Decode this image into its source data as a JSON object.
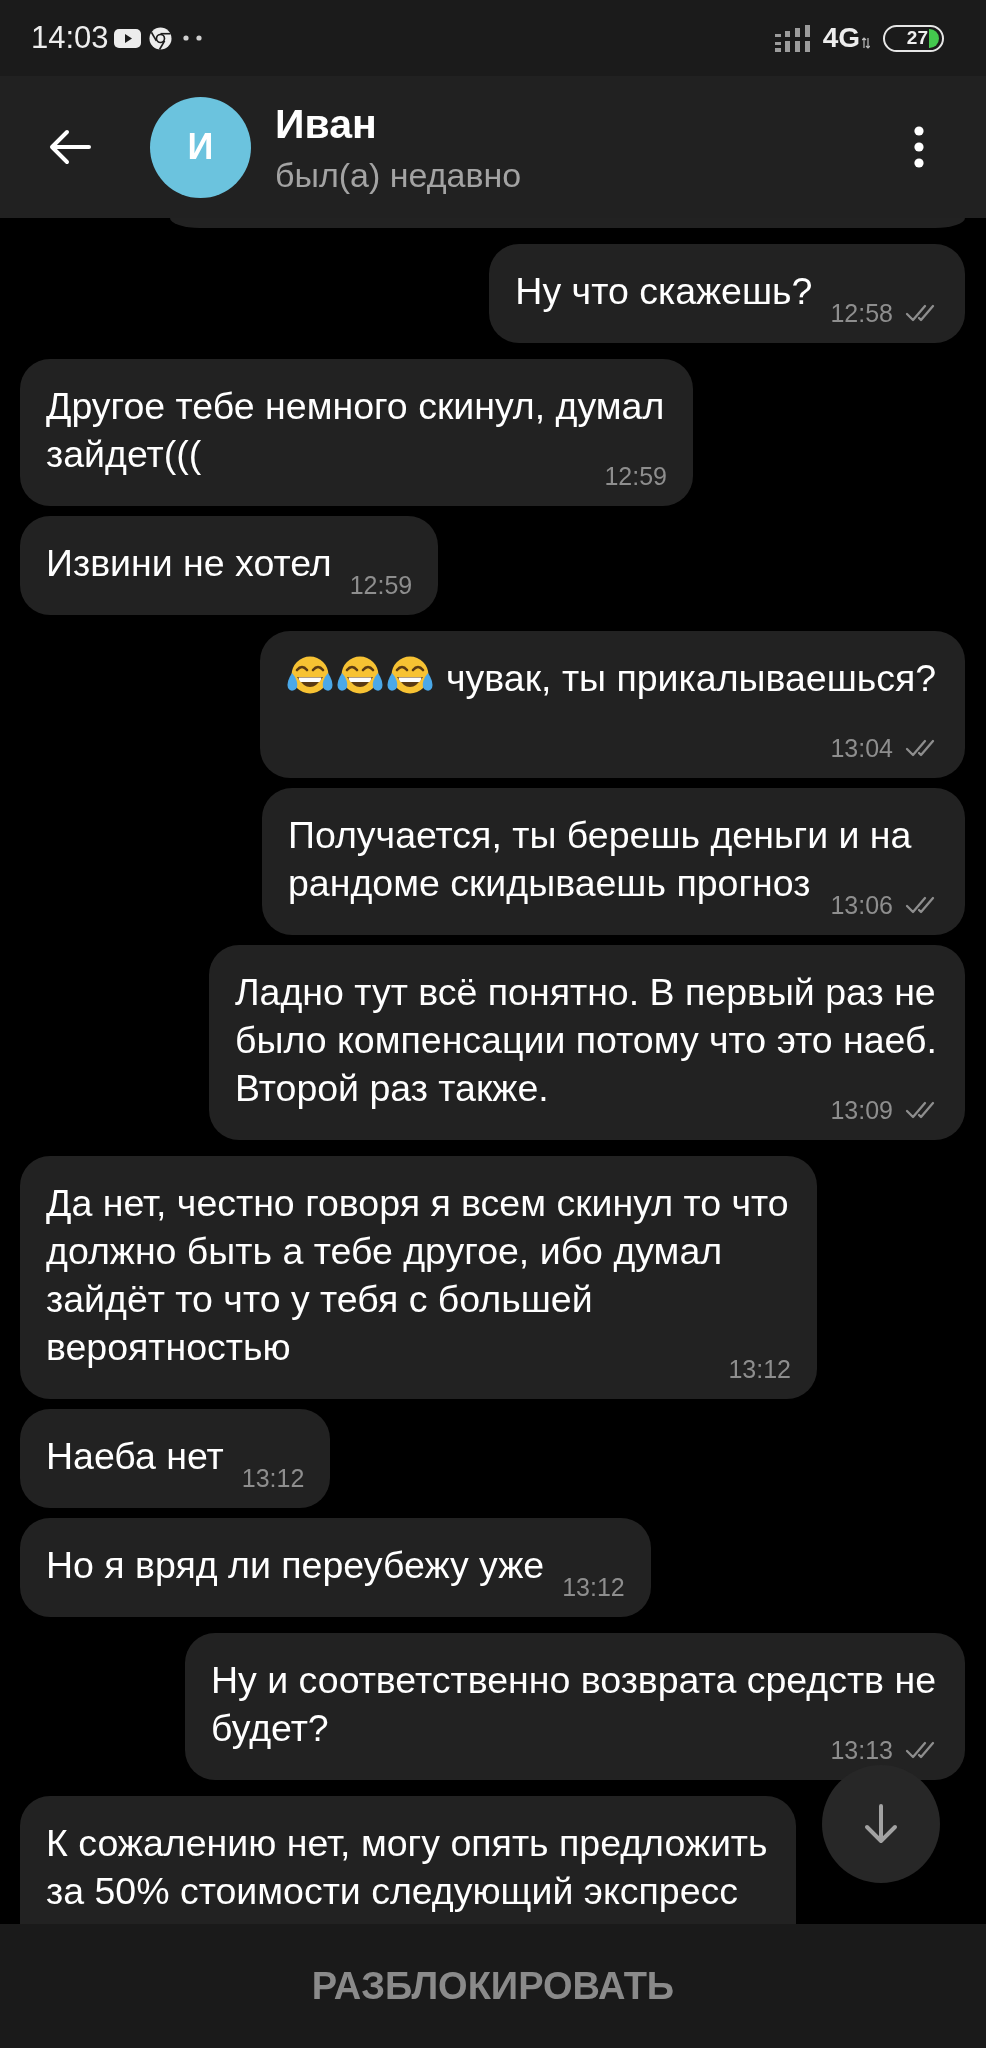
{
  "status_bar": {
    "time": "14:03",
    "network": "4G",
    "battery": "27"
  },
  "header": {
    "avatar_letter": "И",
    "name": "Иван",
    "status": "был(а) недавно"
  },
  "messages": [
    {
      "kind": "outgoing"
    },
    {
      "kind": "outgoing",
      "text": "Ну что скажешь?",
      "time": "12:58",
      "read": true
    },
    {
      "kind": "incoming",
      "text": "Другое тебе немного скинул, думал зайдет(((",
      "time": "12:59"
    },
    {
      "kind": "incoming",
      "text": "Извини не хотел",
      "time": "12:59"
    },
    {
      "kind": "outgoing",
      "emojis": [
        {
          "kind": "tears_of_joy"
        },
        {
          "kind": "tears_of_joy"
        },
        {
          "kind": "tears_of_joy"
        }
      ],
      "text": "чувак, ты прикалываешься?",
      "time": "13:04",
      "read": true
    },
    {
      "kind": "outgoing",
      "text": "Получается, ты берешь деньги и на рандоме скидываешь прогноз",
      "time": "13:06",
      "read": true
    },
    {
      "kind": "outgoing",
      "text": "Ладно тут всё понятно. В первый раз не было компенсации потому что это наеб. Второй раз также.",
      "time": "13:09",
      "read": true
    },
    {
      "kind": "incoming",
      "text": "Да нет, честно говоря я всем скинул то что должно быть а тебе другое, ибо думал зайдёт то что у тебя с большей вероятностью",
      "time": "13:12"
    },
    {
      "kind": "incoming",
      "text": "Наеба нет",
      "time": "13:12"
    },
    {
      "kind": "incoming",
      "text": "Но я вряд ли переубежу уже",
      "time": "13:12"
    },
    {
      "kind": "outgoing",
      "text": "Ну и соответственно возврата средств не будет?",
      "time": "13:13",
      "read": true
    },
    {
      "kind": "incoming",
      "text": "К сожалению нет, могу опять предложить за 50% стоимости следующий экспресс"
    }
  ],
  "unblock_button": {
    "label": "РАЗБЛОКИРОВАТЬ"
  }
}
